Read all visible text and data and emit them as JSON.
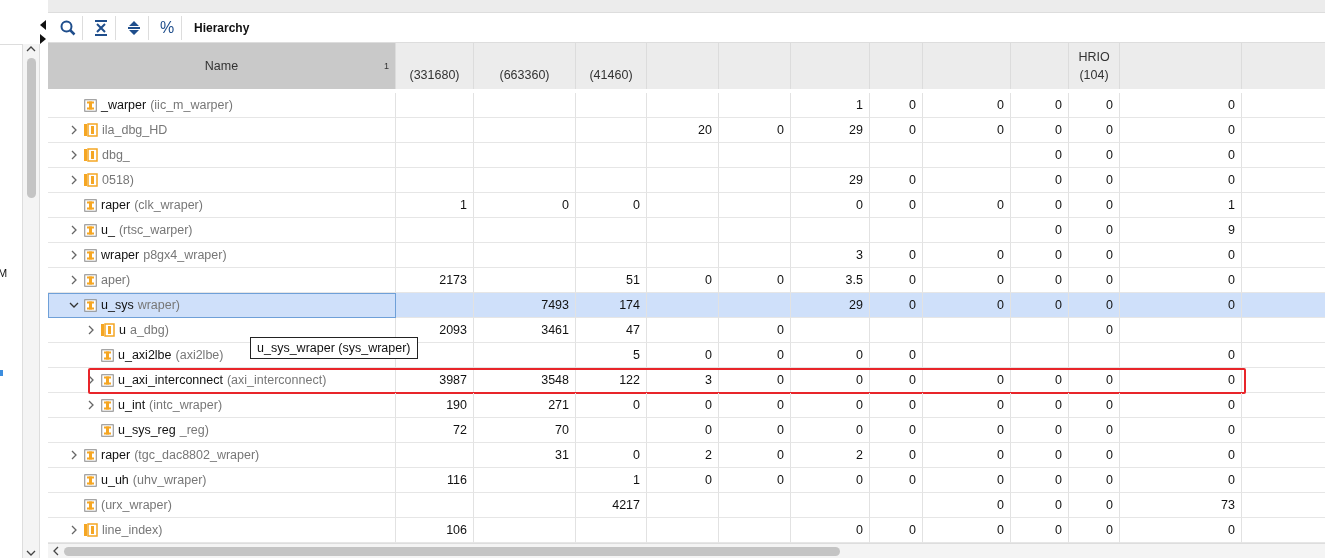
{
  "left_panel": {
    "letter": "M"
  },
  "toolbar": {
    "percent": "%",
    "title": "Hierarchy"
  },
  "table": {
    "name_header": "Name",
    "sort_index": "1",
    "columns": [
      {
        "count": "(331680)"
      },
      {
        "count": "(663360)"
      },
      {
        "count": "(41460)"
      },
      null,
      null,
      null,
      null,
      null,
      null,
      {
        "title": "HRIO",
        "count": "(104)"
      },
      null,
      null
    ],
    "rows": [
      {
        "name": "_warper",
        "module": "(iic_m_warper)",
        "kind": "single",
        "selected": false,
        "highlighted": false,
        "cells": [
          null,
          null,
          null,
          null,
          null,
          "1",
          "0",
          "0",
          "0",
          "0",
          "0"
        ]
      },
      {
        "name": null,
        "module": "ila_dbg_HD",
        "kind": "multi",
        "expanded": false,
        "selected": false,
        "highlighted": false,
        "cells": [
          null,
          null,
          null,
          "20",
          "0",
          "29",
          "0",
          "0",
          "0",
          "0",
          "0"
        ]
      },
      {
        "name": null,
        "module": "dbg_",
        "kind": "multi",
        "expanded": false,
        "selected": false,
        "highlighted": false,
        "cells": [
          null,
          null,
          null,
          null,
          null,
          null,
          null,
          null,
          "0",
          "0",
          "0"
        ]
      },
      {
        "name": null,
        "module": "0518)",
        "kind": "multi",
        "expanded": false,
        "selected": false,
        "highlighted": false,
        "cells": [
          null,
          null,
          null,
          null,
          null,
          "29",
          "0",
          null,
          "0",
          "0",
          "0"
        ]
      },
      {
        "name": "raper",
        "module": "(clk_wraper)",
        "kind": "single",
        "selected": false,
        "highlighted": false,
        "cells": [
          "1",
          "0",
          "0",
          null,
          null,
          "0",
          "0",
          "0",
          "0",
          "0",
          "1"
        ]
      },
      {
        "name": "u_",
        "module": "(rtsc_warper)",
        "kind": "single",
        "expanded": false,
        "selected": false,
        "highlighted": false,
        "cells": [
          null,
          null,
          null,
          null,
          null,
          null,
          null,
          null,
          "0",
          "0",
          "9"
        ]
      },
      {
        "name": "wraper",
        "module": "p8gx4_wraper)",
        "kind": "single",
        "expanded": false,
        "selected": false,
        "highlighted": false,
        "cells": [
          null,
          null,
          null,
          null,
          null,
          "3",
          "0",
          "0",
          "0",
          "0",
          "0"
        ]
      },
      {
        "name": null,
        "module": "aper)",
        "kind": "single",
        "expanded": false,
        "selected": false,
        "highlighted": false,
        "cells": [
          "2173",
          null,
          "51",
          "0",
          "0",
          "3.5",
          "0",
          "0",
          "0",
          "0",
          "0"
        ]
      },
      {
        "name": "u_sys",
        "module": "wraper)",
        "kind": "single",
        "expanded": true,
        "selected": true,
        "highlighted": false,
        "cells": [
          null,
          "7493",
          "174",
          null,
          null,
          "29",
          "0",
          "0",
          "0",
          "0",
          "0"
        ],
        "children": [
          {
            "name": "u",
            "module": "a_dbg)",
            "kind": "multi",
            "expanded": false,
            "selected": false,
            "highlighted": false,
            "cells": [
              "2093",
              "3461",
              "47",
              null,
              "0",
              null,
              null,
              null,
              null,
              "0",
              null
            ]
          },
          {
            "name": "u_axi2lbe",
            "module": "(axi2lbe)",
            "kind": "single",
            "selected": false,
            "highlighted": false,
            "cells": [
              null,
              null,
              "5",
              "0",
              "0",
              "0",
              "0",
              null,
              null,
              null,
              "0"
            ]
          },
          {
            "name": "u_axi_interconnect",
            "module": "(axi_interconnect)",
            "kind": "single",
            "expanded": false,
            "selected": false,
            "highlighted": true,
            "cells": [
              "3987",
              "3548",
              "122",
              "3",
              "0",
              "0",
              "0",
              "0",
              "0",
              "0",
              "0"
            ]
          },
          {
            "name": "u_int",
            "module": "(intc_wraper)",
            "kind": "single",
            "expanded": false,
            "selected": false,
            "highlighted": false,
            "cells": [
              "190",
              "271",
              "0",
              "0",
              "0",
              "0",
              "0",
              "0",
              "0",
              "0",
              "0"
            ]
          },
          {
            "name": "u_sys_reg",
            "module": "_reg)",
            "kind": "single",
            "selected": false,
            "highlighted": false,
            "cells": [
              "72",
              "70",
              null,
              "0",
              "0",
              "0",
              "0",
              "0",
              "0",
              "0",
              "0"
            ]
          }
        ]
      },
      {
        "name": "raper",
        "module": "(tgc_dac8802_wraper)",
        "kind": "single",
        "expanded": false,
        "selected": false,
        "highlighted": false,
        "cells": [
          null,
          "31",
          "0",
          "2",
          "0",
          "2",
          "0",
          "0",
          "0",
          "0",
          "0"
        ]
      },
      {
        "name": "u_uh",
        "module": "(uhv_wraper)",
        "kind": "single",
        "selected": false,
        "highlighted": false,
        "cells": [
          "116",
          null,
          "1",
          "0",
          "0",
          "0",
          "0",
          "0",
          "0",
          "0",
          "0"
        ]
      },
      {
        "name": null,
        "module": "(urx_wraper)",
        "kind": "single",
        "selected": false,
        "highlighted": false,
        "cells": [
          null,
          null,
          "4217",
          null,
          null,
          null,
          null,
          "0",
          "0",
          "0",
          "73"
        ]
      },
      {
        "name": null,
        "module": "line_index)",
        "kind": "multi",
        "expanded": false,
        "selected": false,
        "highlighted": false,
        "cells": [
          "106",
          null,
          null,
          null,
          null,
          "0",
          "0",
          "0",
          "0",
          "0",
          "0"
        ]
      }
    ]
  },
  "tooltip": "u_sys_wraper (sys_wraper)"
}
